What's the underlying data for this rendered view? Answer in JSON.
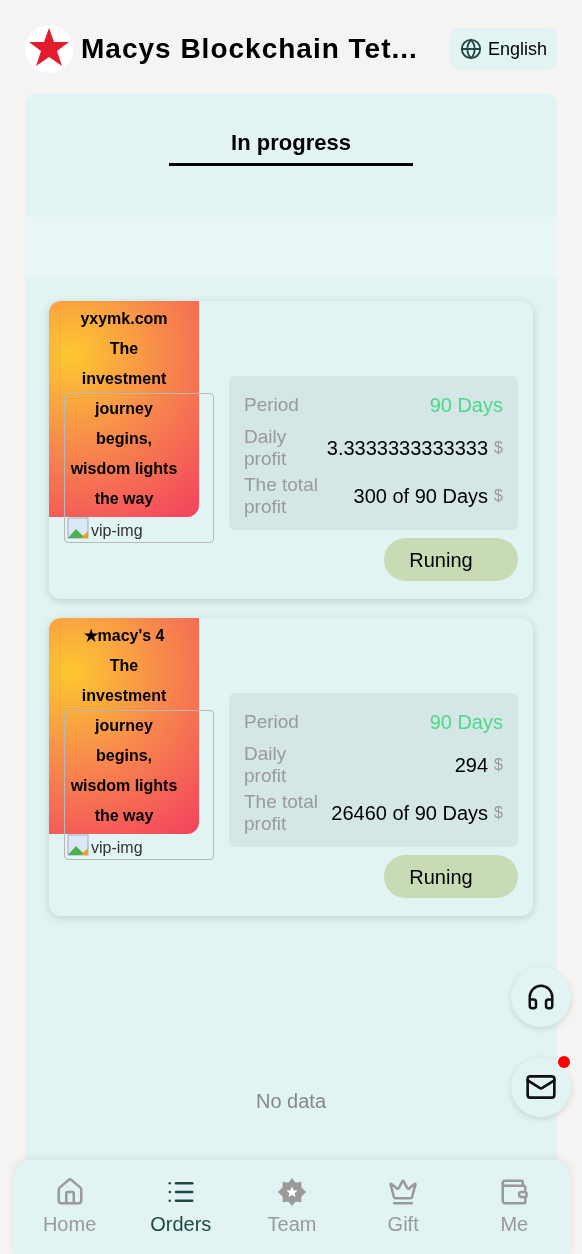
{
  "header": {
    "title": "Macys Blockchain Tet...",
    "language": "English"
  },
  "tabs": [
    {
      "label": "In progress",
      "selected": true
    }
  ],
  "orders": [
    {
      "banner": [
        "yxymk.com",
        "The",
        "investment",
        "journey",
        "begins,",
        "wisdom lights",
        "the way"
      ],
      "image_alt": "vip-img",
      "rows": [
        {
          "label": "Period",
          "value": "90 Days",
          "kind": "highlight"
        },
        {
          "label": "Daily profit",
          "value": "3.3333333333333",
          "unit": "$",
          "kind": "money"
        },
        {
          "label": "The total profit",
          "value": "300 of 90 Days",
          "unit": "$",
          "kind": "money"
        }
      ],
      "status": "Runing"
    },
    {
      "banner": [
        "★macy's 4",
        "The",
        "investment",
        "journey",
        "begins,",
        "wisdom lights",
        "the way"
      ],
      "image_alt": "vip-img",
      "rows": [
        {
          "label": "Period",
          "value": "90 Days",
          "kind": "highlight"
        },
        {
          "label": "Daily profit",
          "value": "294",
          "unit": "$",
          "kind": "money"
        },
        {
          "label": "The total profit",
          "value": "26460 of 90 Days",
          "unit": "$",
          "kind": "money"
        }
      ],
      "status": "Runing"
    }
  ],
  "empty_text": "No data",
  "floating": {
    "mail_unread": true
  },
  "nav": [
    {
      "label": "Home",
      "selected": false
    },
    {
      "label": "Orders",
      "selected": true
    },
    {
      "label": "Team",
      "selected": false
    },
    {
      "label": "Gift",
      "selected": false
    },
    {
      "label": "Me",
      "selected": false
    }
  ]
}
